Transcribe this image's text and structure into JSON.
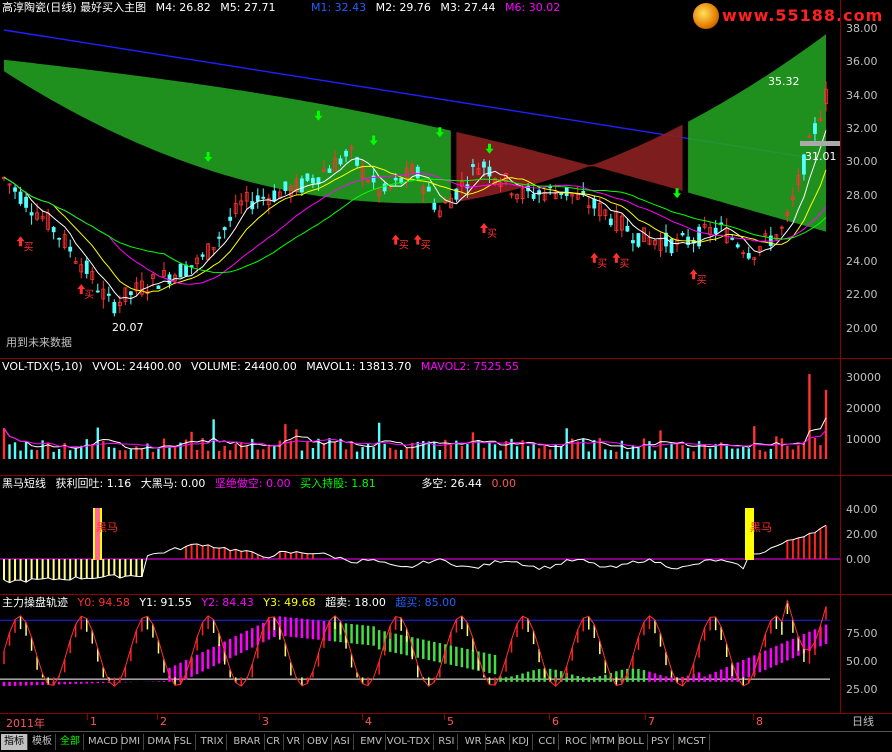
{
  "main": {
    "title": "高淳陶瓷(日线) 最好买入主图",
    "m4": "M4: 26.82",
    "m5": "M5: 27.71",
    "m1": "M1: 32.43",
    "m2": "M2: 29.76",
    "m3": "M3: 27.44",
    "m6": "M6: 30.02",
    "high_label": "35.32",
    "low_label": "20.07",
    "last_label": "31.01",
    "future_note": "用到未来数据",
    "y_ticks": [
      "38.00",
      "36.00",
      "34.00",
      "32.00",
      "30.00",
      "28.00",
      "26.00",
      "24.00",
      "22.00",
      "20.00"
    ],
    "buy_marker": "买"
  },
  "vol": {
    "title": "VOL-TDX(5,10)",
    "vvol": "VVOL: 24400.00",
    "volume": "VOLUME: 24400.00",
    "mavol1": "MAVOL1: 13813.70",
    "mavol2": "MAVOL2: 7525.55",
    "y_ticks": [
      "30000",
      "20000",
      "10000"
    ]
  },
  "heima": {
    "title": "黑马短线",
    "fields": [
      {
        "text": "获利回吐: 1.16",
        "color": "#ffffff"
      },
      {
        "text": "大黑马: 0.00",
        "color": "#ffffff"
      },
      {
        "text": "坚绝做空: 0.00",
        "color": "#ff00ff"
      },
      {
        "text": "买入持股: 1.81",
        "color": "#00ff00"
      },
      {
        "text": "多空: 26.44",
        "color": "#ffffff"
      },
      {
        "text": "0.00",
        "color": "#ff5555"
      }
    ],
    "marker": "黑马",
    "y_ticks": [
      "40.00",
      "20.00",
      "0.00"
    ]
  },
  "zhuli": {
    "title": "主力操盘轨迹",
    "y0": "Y0: 94.58",
    "y1": "Y1: 91.55",
    "y2": "Y2: 84.43",
    "y3": "Y3: 49.68",
    "chaomai": "超卖: 18.00",
    "chaomai2": "超买: 85.00",
    "y_ticks": [
      "75.00",
      "50.00",
      "25.00"
    ]
  },
  "dates": {
    "year": "2011年",
    "months": [
      "1",
      "2",
      "3",
      "4",
      "5",
      "6",
      "7",
      "8"
    ],
    "period": "日线"
  },
  "tabs": [
    "指标",
    "模板",
    "全部",
    "MACD",
    "DMI",
    "DMA",
    "FSL",
    "TRIX",
    "BRAR",
    "CR",
    "VR",
    "OBV",
    "ASI",
    "EMV",
    "VOL-TDX",
    "RSI",
    "WR",
    "SAR",
    "KDJ",
    "CCI",
    "ROC",
    "MTM",
    "BOLL",
    "PSY",
    "MCST"
  ],
  "colors": {
    "up": "#ff3232",
    "down": "#54ffff",
    "ma_blue": "#2020ff",
    "band_green": "#22a020",
    "band_red": "#8b2020",
    "yellow": "#ffff00",
    "magenta": "#ff00ff"
  },
  "watermark": "www.55188.com"
}
